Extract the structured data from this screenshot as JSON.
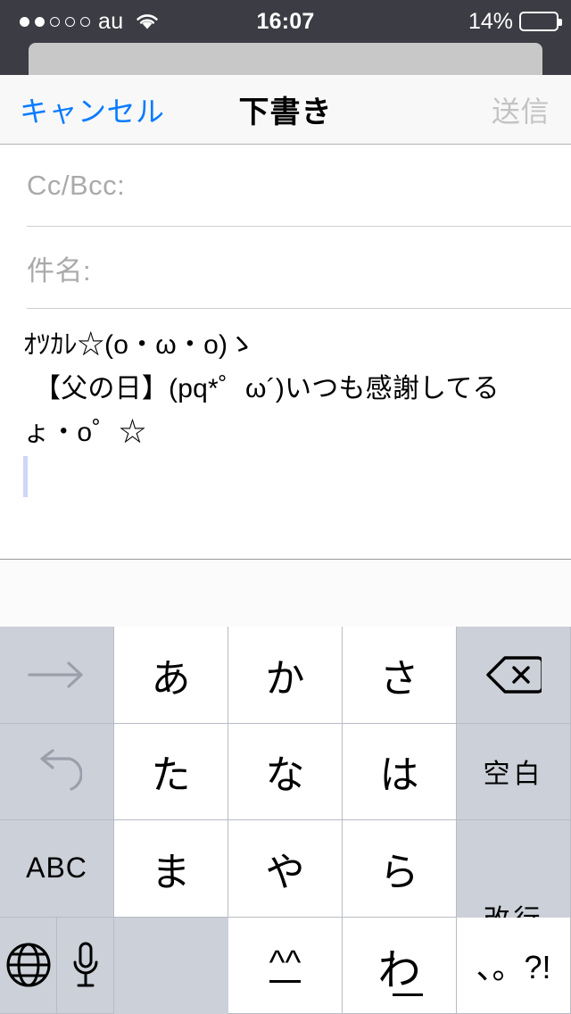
{
  "status_bar": {
    "signal_dots_total": 5,
    "signal_dots_filled": 2,
    "carrier": "au",
    "wifi_icon": "wifi-icon",
    "time": "16:07",
    "battery_percent": "14%",
    "battery_level": 14,
    "battery_color": "#ffcc00"
  },
  "nav": {
    "cancel_label": "キャンセル",
    "title": "下書き",
    "send_label": "送信",
    "cancel_color": "#0a7cff",
    "send_color": "#c3c3c3"
  },
  "compose": {
    "cc_bcc_placeholder": "Cc/Bcc:",
    "subject_placeholder": "件名:",
    "body_lines": [
      "ｵﾂｶﾚ☆(o・ω・o)ゝ",
      "【父の日】(pq*゜ω´)いつも感謝してる",
      "ょ・o゜☆"
    ]
  },
  "predictive_bar": {
    "suggestions": []
  },
  "keyboard": {
    "layout": "japanese-kana-10key",
    "rows": [
      [
        {
          "name": "next-candidate-key",
          "label": "→",
          "style": "gray dim func"
        },
        {
          "name": "kana-a-key",
          "label": "あ",
          "style": "white"
        },
        {
          "name": "kana-ka-key",
          "label": "か",
          "style": "white"
        },
        {
          "name": "kana-sa-key",
          "label": "さ",
          "style": "white"
        },
        {
          "name": "backspace-key",
          "label": "⌫",
          "style": "gray icon"
        }
      ],
      [
        {
          "name": "undo-key",
          "label": "↺",
          "style": "gray dim func"
        },
        {
          "name": "kana-ta-key",
          "label": "た",
          "style": "white"
        },
        {
          "name": "kana-na-key",
          "label": "な",
          "style": "white"
        },
        {
          "name": "kana-ha-key",
          "label": "は",
          "style": "white"
        },
        {
          "name": "space-key",
          "label": "空白",
          "style": "gray small"
        }
      ],
      [
        {
          "name": "abc-mode-key",
          "label": "ABC",
          "style": "gray abc"
        },
        {
          "name": "kana-ma-key",
          "label": "ま",
          "style": "white"
        },
        {
          "name": "kana-ya-key",
          "label": "や",
          "style": "white"
        },
        {
          "name": "kana-ra-key",
          "label": "ら",
          "style": "white"
        },
        {
          "name": "return-key",
          "label": "改行",
          "style": "gray small"
        }
      ],
      [
        {
          "name": "globe-key",
          "label": "🌐",
          "style": "gray icon"
        },
        {
          "name": "dictation-key",
          "label": "🎤",
          "style": "gray icon"
        },
        {
          "name": "emoticon-key",
          "label": "^_^",
          "style": "white small"
        },
        {
          "name": "kana-wa-key",
          "label": "わ",
          "style": "white"
        },
        {
          "name": "punctuation-key",
          "label": "、。?!",
          "style": "white small"
        }
      ]
    ]
  }
}
